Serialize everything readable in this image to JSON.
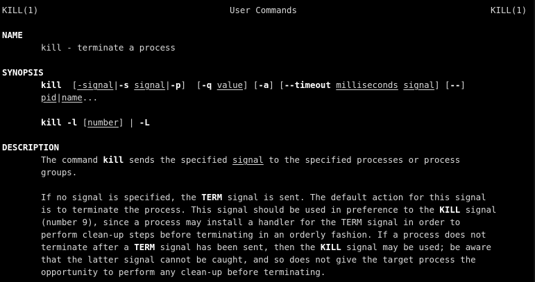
{
  "header": {
    "left": "KILL(1)",
    "center": "User Commands",
    "right": "KILL(1)"
  },
  "name_section": {
    "heading": "NAME",
    "text": "kill - terminate a process"
  },
  "synopsis_section": {
    "heading": "SYNOPSIS",
    "line1": {
      "cmd": "kill",
      "sp1": "  [",
      "opt_signal": "-signal",
      "bar1": "|",
      "opt_s": "-s",
      "sp2": " ",
      "arg_signal": "signal",
      "bar2": "|",
      "opt_p": "-p",
      "sp3": "]  [",
      "opt_q": "-q",
      "sp4": " ",
      "arg_value": "value",
      "sp5": "] [",
      "opt_a": "-a",
      "sp6": "] [",
      "opt_timeout": "--timeout",
      "sp7": " ",
      "arg_ms": "milliseconds",
      "sp8": " ",
      "arg_signal2": "signal",
      "sp9": "] [",
      "opt_dd": "--",
      "end": "]"
    },
    "line2": {
      "arg_pid": "pid",
      "bar": "|",
      "arg_name": "name",
      "ellipsis": "..."
    },
    "line3": {
      "cmd": "kill",
      "sp1": " ",
      "opt_l": "-l",
      "sp2": " [",
      "arg_number": "number",
      "sp3": "] | ",
      "opt_L": "-L"
    }
  },
  "description_section": {
    "heading": "DESCRIPTION",
    "p1_l1_a": "The command ",
    "p1_l1_kill": "kill",
    "p1_l1_b": " sends the specified ",
    "p1_l1_signal": "signal",
    "p1_l1_c": " to the specified processes or process",
    "p1_l2": "groups.",
    "p2_l1_a": "If no signal is specified, the ",
    "p2_l1_term": "TERM",
    "p2_l1_b": " signal is sent. The default action for this signal",
    "p2_l2_a": "is to terminate the process. This signal should be used in preference to the ",
    "p2_l2_kill": "KILL",
    "p2_l2_b": " signal",
    "p2_l3": "(number 9), since a process may install a handler for the TERM signal in order to",
    "p2_l4": "perform clean-up steps before terminating in an orderly fashion. If a process does not",
    "p2_l5_a": "terminate after a ",
    "p2_l5_term": "TERM",
    "p2_l5_b": " signal has been sent, then the ",
    "p2_l5_kill": "KILL",
    "p2_l5_c": " signal may be used; be aware",
    "p2_l6": "that the latter signal cannot be caught, and so does not give the target process the",
    "p2_l7": "opportunity to perform any clean-up before terminating."
  },
  "colors": {
    "background": "#000000",
    "text": "#d8d8d8",
    "bold": "#ffffff"
  }
}
